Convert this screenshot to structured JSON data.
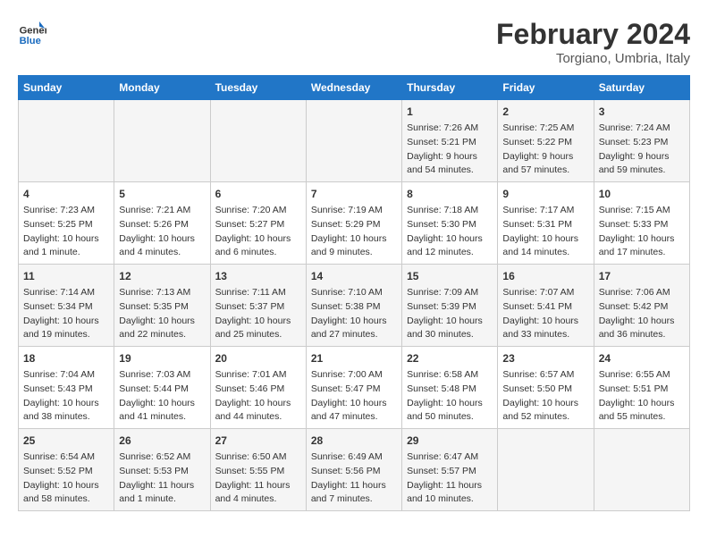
{
  "header": {
    "logo_general": "General",
    "logo_blue": "Blue",
    "month_title": "February 2024",
    "location": "Torgiano, Umbria, Italy"
  },
  "columns": [
    "Sunday",
    "Monday",
    "Tuesday",
    "Wednesday",
    "Thursday",
    "Friday",
    "Saturday"
  ],
  "weeks": [
    {
      "days": [
        {
          "num": "",
          "content": ""
        },
        {
          "num": "",
          "content": ""
        },
        {
          "num": "",
          "content": ""
        },
        {
          "num": "",
          "content": ""
        },
        {
          "num": "1",
          "content": "Sunrise: 7:26 AM\nSunset: 5:21 PM\nDaylight: 9 hours\nand 54 minutes."
        },
        {
          "num": "2",
          "content": "Sunrise: 7:25 AM\nSunset: 5:22 PM\nDaylight: 9 hours\nand 57 minutes."
        },
        {
          "num": "3",
          "content": "Sunrise: 7:24 AM\nSunset: 5:23 PM\nDaylight: 9 hours\nand 59 minutes."
        }
      ]
    },
    {
      "days": [
        {
          "num": "4",
          "content": "Sunrise: 7:23 AM\nSunset: 5:25 PM\nDaylight: 10 hours\nand 1 minute."
        },
        {
          "num": "5",
          "content": "Sunrise: 7:21 AM\nSunset: 5:26 PM\nDaylight: 10 hours\nand 4 minutes."
        },
        {
          "num": "6",
          "content": "Sunrise: 7:20 AM\nSunset: 5:27 PM\nDaylight: 10 hours\nand 6 minutes."
        },
        {
          "num": "7",
          "content": "Sunrise: 7:19 AM\nSunset: 5:29 PM\nDaylight: 10 hours\nand 9 minutes."
        },
        {
          "num": "8",
          "content": "Sunrise: 7:18 AM\nSunset: 5:30 PM\nDaylight: 10 hours\nand 12 minutes."
        },
        {
          "num": "9",
          "content": "Sunrise: 7:17 AM\nSunset: 5:31 PM\nDaylight: 10 hours\nand 14 minutes."
        },
        {
          "num": "10",
          "content": "Sunrise: 7:15 AM\nSunset: 5:33 PM\nDaylight: 10 hours\nand 17 minutes."
        }
      ]
    },
    {
      "days": [
        {
          "num": "11",
          "content": "Sunrise: 7:14 AM\nSunset: 5:34 PM\nDaylight: 10 hours\nand 19 minutes."
        },
        {
          "num": "12",
          "content": "Sunrise: 7:13 AM\nSunset: 5:35 PM\nDaylight: 10 hours\nand 22 minutes."
        },
        {
          "num": "13",
          "content": "Sunrise: 7:11 AM\nSunset: 5:37 PM\nDaylight: 10 hours\nand 25 minutes."
        },
        {
          "num": "14",
          "content": "Sunrise: 7:10 AM\nSunset: 5:38 PM\nDaylight: 10 hours\nand 27 minutes."
        },
        {
          "num": "15",
          "content": "Sunrise: 7:09 AM\nSunset: 5:39 PM\nDaylight: 10 hours\nand 30 minutes."
        },
        {
          "num": "16",
          "content": "Sunrise: 7:07 AM\nSunset: 5:41 PM\nDaylight: 10 hours\nand 33 minutes."
        },
        {
          "num": "17",
          "content": "Sunrise: 7:06 AM\nSunset: 5:42 PM\nDaylight: 10 hours\nand 36 minutes."
        }
      ]
    },
    {
      "days": [
        {
          "num": "18",
          "content": "Sunrise: 7:04 AM\nSunset: 5:43 PM\nDaylight: 10 hours\nand 38 minutes."
        },
        {
          "num": "19",
          "content": "Sunrise: 7:03 AM\nSunset: 5:44 PM\nDaylight: 10 hours\nand 41 minutes."
        },
        {
          "num": "20",
          "content": "Sunrise: 7:01 AM\nSunset: 5:46 PM\nDaylight: 10 hours\nand 44 minutes."
        },
        {
          "num": "21",
          "content": "Sunrise: 7:00 AM\nSunset: 5:47 PM\nDaylight: 10 hours\nand 47 minutes."
        },
        {
          "num": "22",
          "content": "Sunrise: 6:58 AM\nSunset: 5:48 PM\nDaylight: 10 hours\nand 50 minutes."
        },
        {
          "num": "23",
          "content": "Sunrise: 6:57 AM\nSunset: 5:50 PM\nDaylight: 10 hours\nand 52 minutes."
        },
        {
          "num": "24",
          "content": "Sunrise: 6:55 AM\nSunset: 5:51 PM\nDaylight: 10 hours\nand 55 minutes."
        }
      ]
    },
    {
      "days": [
        {
          "num": "25",
          "content": "Sunrise: 6:54 AM\nSunset: 5:52 PM\nDaylight: 10 hours\nand 58 minutes."
        },
        {
          "num": "26",
          "content": "Sunrise: 6:52 AM\nSunset: 5:53 PM\nDaylight: 11 hours\nand 1 minute."
        },
        {
          "num": "27",
          "content": "Sunrise: 6:50 AM\nSunset: 5:55 PM\nDaylight: 11 hours\nand 4 minutes."
        },
        {
          "num": "28",
          "content": "Sunrise: 6:49 AM\nSunset: 5:56 PM\nDaylight: 11 hours\nand 7 minutes."
        },
        {
          "num": "29",
          "content": "Sunrise: 6:47 AM\nSunset: 5:57 PM\nDaylight: 11 hours\nand 10 minutes."
        },
        {
          "num": "",
          "content": ""
        },
        {
          "num": "",
          "content": ""
        }
      ]
    }
  ]
}
